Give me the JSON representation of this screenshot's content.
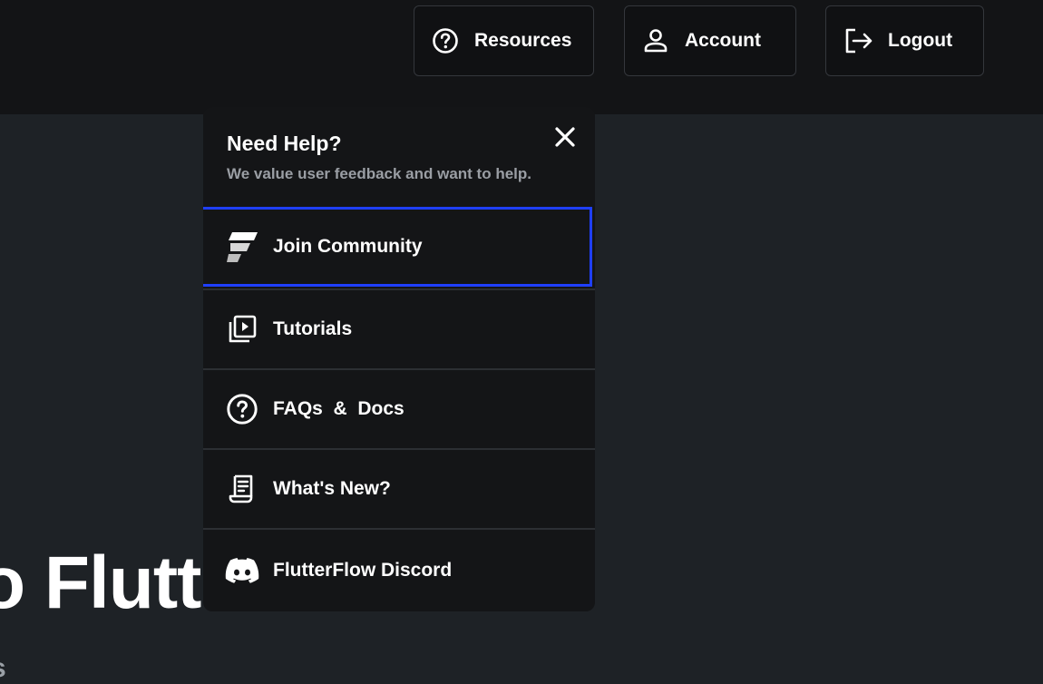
{
  "header": {
    "resources_label": "Resources",
    "account_label": "Account",
    "logout_label": "Logout"
  },
  "background": {
    "title_fragment": "o Flutt",
    "subtitle_fragment": "s"
  },
  "help_popup": {
    "title": "Need Help?",
    "subtitle": "We value user feedback and want to help.",
    "items": [
      {
        "label": "Join Community",
        "icon": "flutterflow-logo-icon",
        "selected": true
      },
      {
        "label": "Tutorials",
        "icon": "video-library-icon",
        "selected": false
      },
      {
        "label": "FAQs  &  Docs",
        "icon": "help-circle-icon",
        "selected": false
      },
      {
        "label": "What's New?",
        "icon": "receipt-icon",
        "selected": false
      },
      {
        "label": "FlutterFlow Discord",
        "icon": "discord-icon",
        "selected": false
      }
    ]
  },
  "colors": {
    "topbar_bg": "#131416",
    "page_bg": "#1e2226",
    "popup_bg": "#141517",
    "selection_outline": "#1f3fff",
    "muted_text": "#9a9ea4"
  }
}
